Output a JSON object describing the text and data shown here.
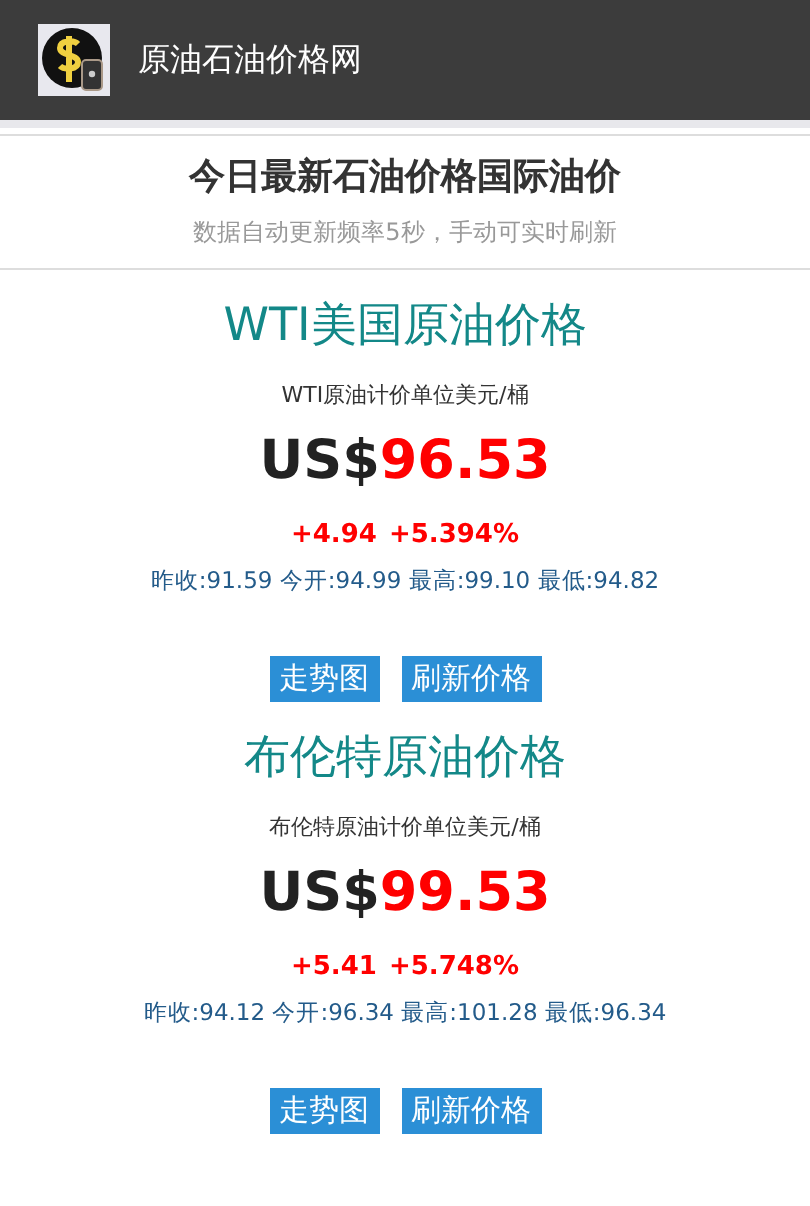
{
  "header": {
    "site_name": "原油石油价格网"
  },
  "intro": {
    "title": "今日最新石油价格国际油价",
    "subtitle": "数据自动更新频率5秒，手动可实时刷新"
  },
  "markets": [
    {
      "name": "WTI美国原油价格",
      "unit": "WTI原油计价单位美元/桶",
      "currency": "US$",
      "price": "96.53",
      "change": "+4.94",
      "change_pct": "+5.394%",
      "stats": "昨收:91.59 今开:94.99 最高:99.10 最低:94.82",
      "buttons": [
        "走势图",
        "刷新价格"
      ]
    },
    {
      "name": "布伦特原油价格",
      "unit": "布伦特原油计价单位美元/桶",
      "currency": "US$",
      "price": "99.53",
      "change": "+5.41",
      "change_pct": "+5.748%",
      "stats": "昨收:94.12 今开:96.34 最高:101.28 最低:96.34",
      "buttons": [
        "走势图",
        "刷新价格"
      ]
    }
  ]
}
